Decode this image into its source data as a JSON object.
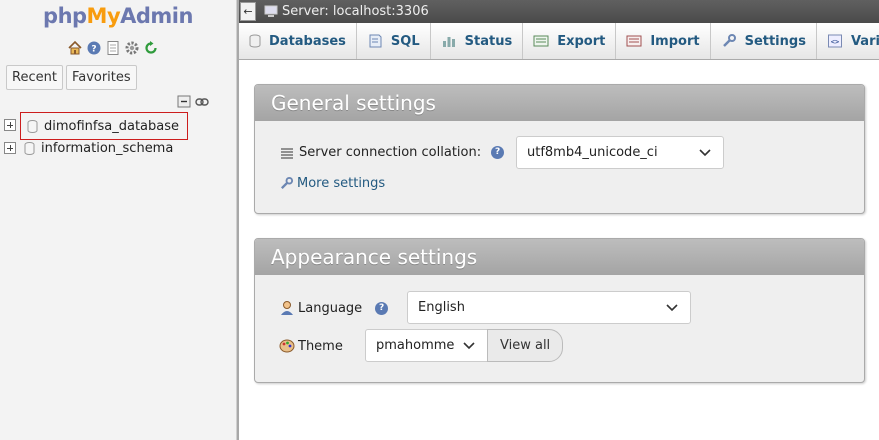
{
  "nav": {
    "logo": {
      "part1": "php",
      "part2": "My",
      "part3": "Admin"
    },
    "icons": [
      "home-icon",
      "help-icon",
      "docs-icon",
      "settings-icon",
      "reload-icon"
    ],
    "tabs": [
      {
        "label": "Recent"
      },
      {
        "label": "Favorites"
      }
    ],
    "databases": [
      {
        "name": "dimofinfsa_database",
        "selected": true
      },
      {
        "name": "information_schema",
        "selected": false
      }
    ]
  },
  "topbar": {
    "server_label": "Server: localhost:3306",
    "back_icon": "←"
  },
  "menu": {
    "tabs": [
      {
        "label": "Databases",
        "icon": "database-icon"
      },
      {
        "label": "SQL",
        "icon": "sql-icon"
      },
      {
        "label": "Status",
        "icon": "status-icon"
      },
      {
        "label": "Export",
        "icon": "export-icon"
      },
      {
        "label": "Import",
        "icon": "import-icon"
      },
      {
        "label": "Settings",
        "icon": "wrench-icon"
      },
      {
        "label": "Variables",
        "icon": "variables-icon"
      }
    ]
  },
  "general": {
    "title": "General settings",
    "collation_label": "Server connection collation:",
    "collation_value": "utf8mb4_unicode_ci",
    "more_settings": "More settings",
    "help": "?"
  },
  "appearance": {
    "title": "Appearance settings",
    "language_label": "Language",
    "language_value": "English",
    "theme_label": "Theme",
    "theme_value": "pmahomme",
    "view_all": "View all",
    "help": "?"
  }
}
